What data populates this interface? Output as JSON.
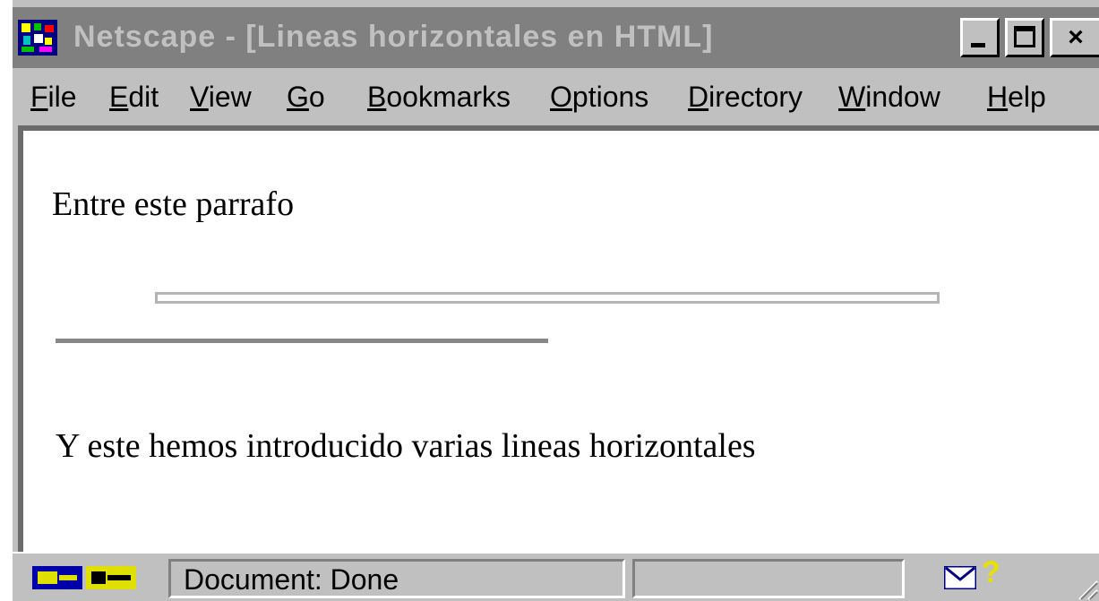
{
  "window": {
    "title": "Netscape - [Lineas horizontales en HTML]",
    "app_icon": "netscape-logo-icon",
    "controls": {
      "minimize": "minimize-icon",
      "maximize": "maximize-icon",
      "close": "×"
    }
  },
  "menubar": {
    "items": [
      {
        "accel": "F",
        "rest": "ile"
      },
      {
        "accel": "E",
        "rest": "dit"
      },
      {
        "accel": "V",
        "rest": "iew"
      },
      {
        "accel": "G",
        "rest": "o"
      },
      {
        "accel": "B",
        "rest": "ookmarks"
      },
      {
        "accel": "O",
        "rest": "ptions"
      },
      {
        "accel": "D",
        "rest": "irectory"
      },
      {
        "accel": "W",
        "rest": "indow"
      },
      {
        "accel": "H",
        "rest": "elp"
      }
    ]
  },
  "page": {
    "paragraph_top": "Entre este parrafo",
    "paragraph_bottom": "Y este hemos introducido varias lineas horizontales"
  },
  "statusbar": {
    "status_text": "Document: Done",
    "progress": 0,
    "icons": [
      "security-key-icon",
      "mail-icon",
      "help-icon"
    ],
    "help_glyph": "?"
  },
  "colors": {
    "title_bar": "#808080",
    "chrome": "#c0c0c0",
    "page_background": "#ffffff",
    "rule_outline": "#b4b4b4",
    "rule_solid": "#888888"
  }
}
